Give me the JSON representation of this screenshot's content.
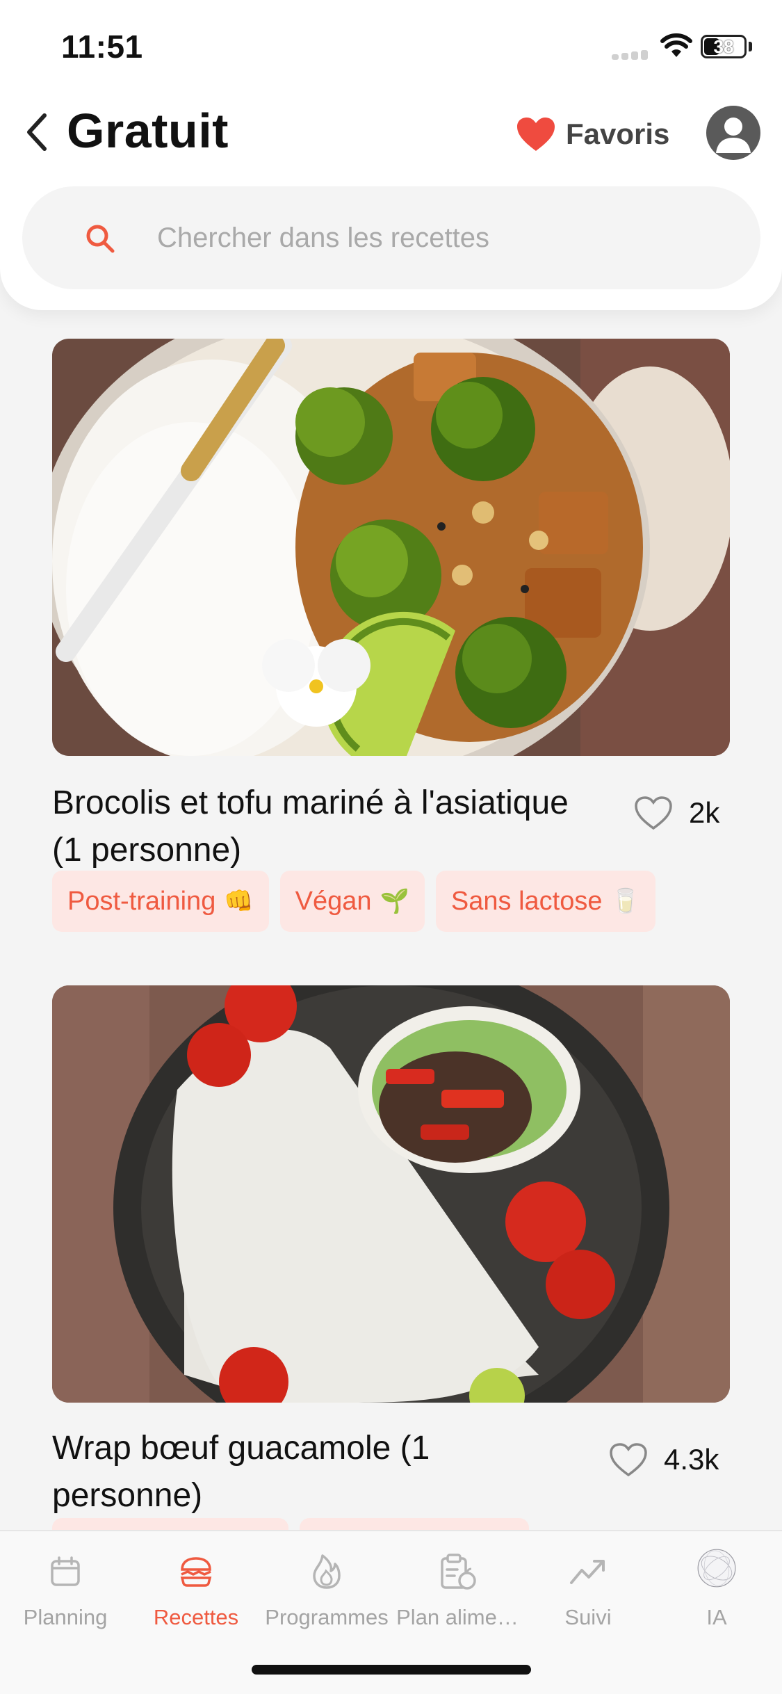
{
  "status_bar": {
    "time": "11:51",
    "battery": "38"
  },
  "header": {
    "title": "Gratuit",
    "favorites_label": "Favoris"
  },
  "search": {
    "placeholder": "Chercher dans les recettes",
    "value": ""
  },
  "colors": {
    "accent": "#ef5a40",
    "tag_bg": "#fde7e4",
    "inactive": "#a4a4a4"
  },
  "recipes": [
    {
      "title": "Brocolis et tofu mariné à l'asiatique (1 personne)",
      "likes": "2k",
      "tags": [
        {
          "label": "Post-training",
          "icon": "👊"
        },
        {
          "label": "Végan",
          "icon": "🌱"
        },
        {
          "label": "Sans lactose",
          "icon": "🥛"
        }
      ]
    },
    {
      "title": "Wrap bœuf guacamole (1 personne)",
      "likes": "4.3k"
    }
  ],
  "tabbar": {
    "items": [
      {
        "label": "Planning",
        "icon": "calendar-icon"
      },
      {
        "label": "Recettes",
        "icon": "burger-icon",
        "active": true
      },
      {
        "label": "Programmes",
        "icon": "flame-icon"
      },
      {
        "label": "Plan alime…",
        "icon": "clipboard-apple-icon"
      },
      {
        "label": "Suivi",
        "icon": "trend-icon"
      },
      {
        "label": "IA",
        "icon": "ai-orb-icon"
      }
    ]
  }
}
